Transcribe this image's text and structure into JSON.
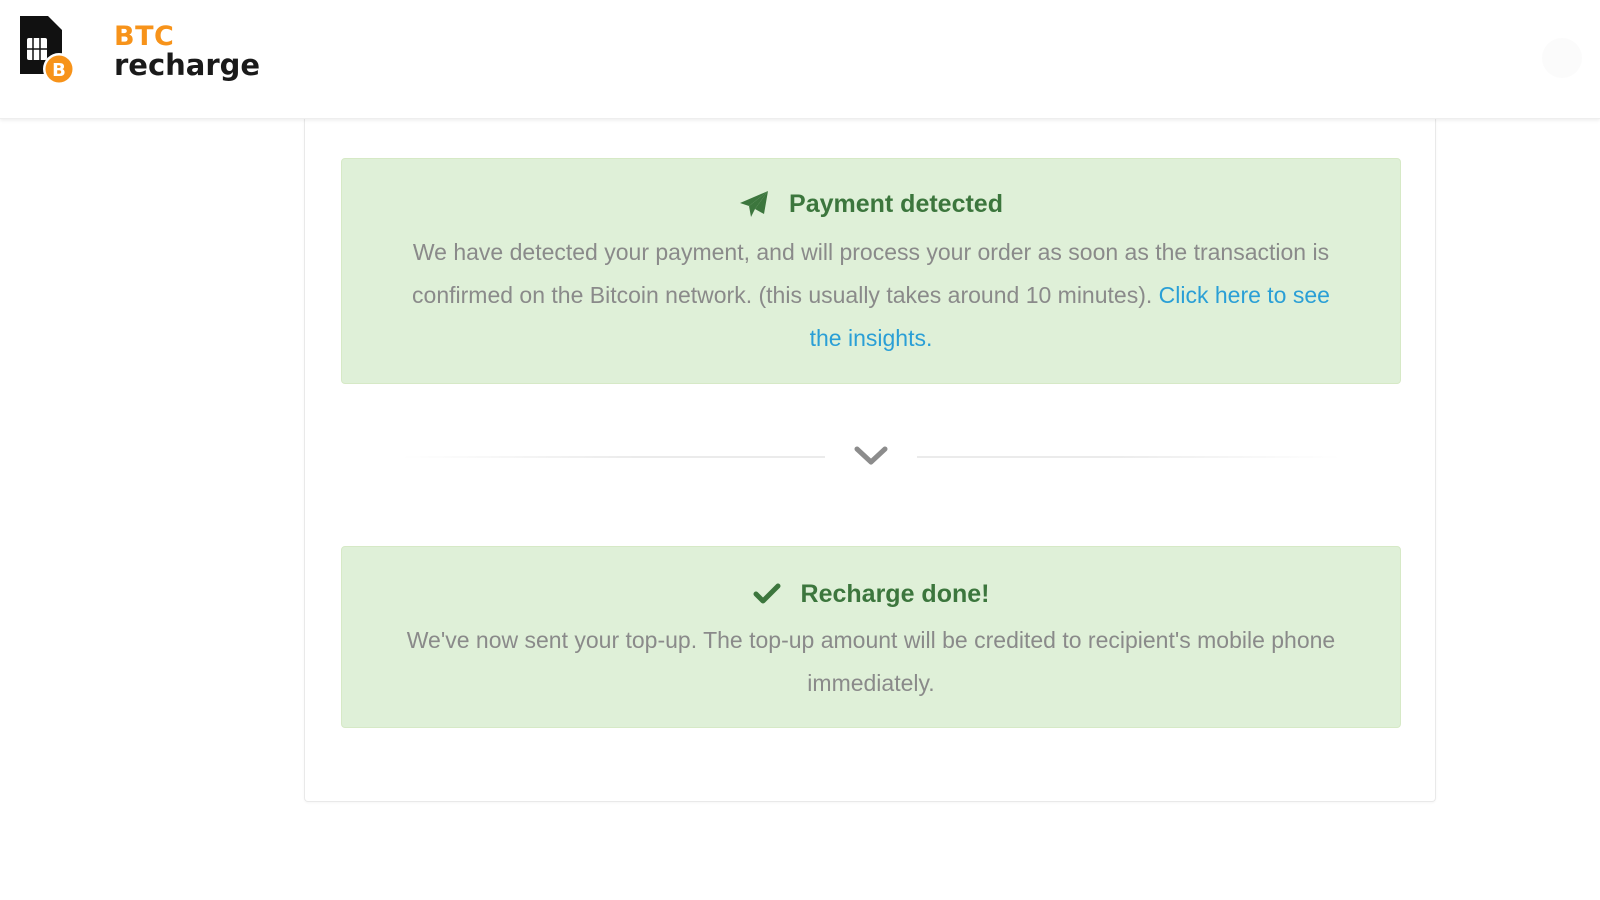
{
  "header": {
    "logo": {
      "line1": "BTC",
      "line2": "recharge",
      "icon": "sim-card-bitcoin-icon",
      "badge_letter": "B"
    }
  },
  "status": {
    "payment_detected": {
      "icon": "paper-plane-icon",
      "title": "Payment detected",
      "message": "We have detected your payment, and will process your order as soon as the transaction is confirmed on the Bitcoin network. (this usually takes around 10 minutes).",
      "link_text": "Click here to see the insights."
    },
    "divider_icon": "chevron-down-icon",
    "recharge_done": {
      "icon": "checkmark-icon",
      "title": "Recharge done!",
      "message": "We've now sent your top-up. The top-up amount will be credited to recipient's mobile phone immediately."
    }
  },
  "colors": {
    "brand_orange": "#f7931a",
    "success_bg": "#dff0d8",
    "success_text": "#3c763d",
    "body_text": "#8a8a8a",
    "link": "#2a9fd6"
  }
}
